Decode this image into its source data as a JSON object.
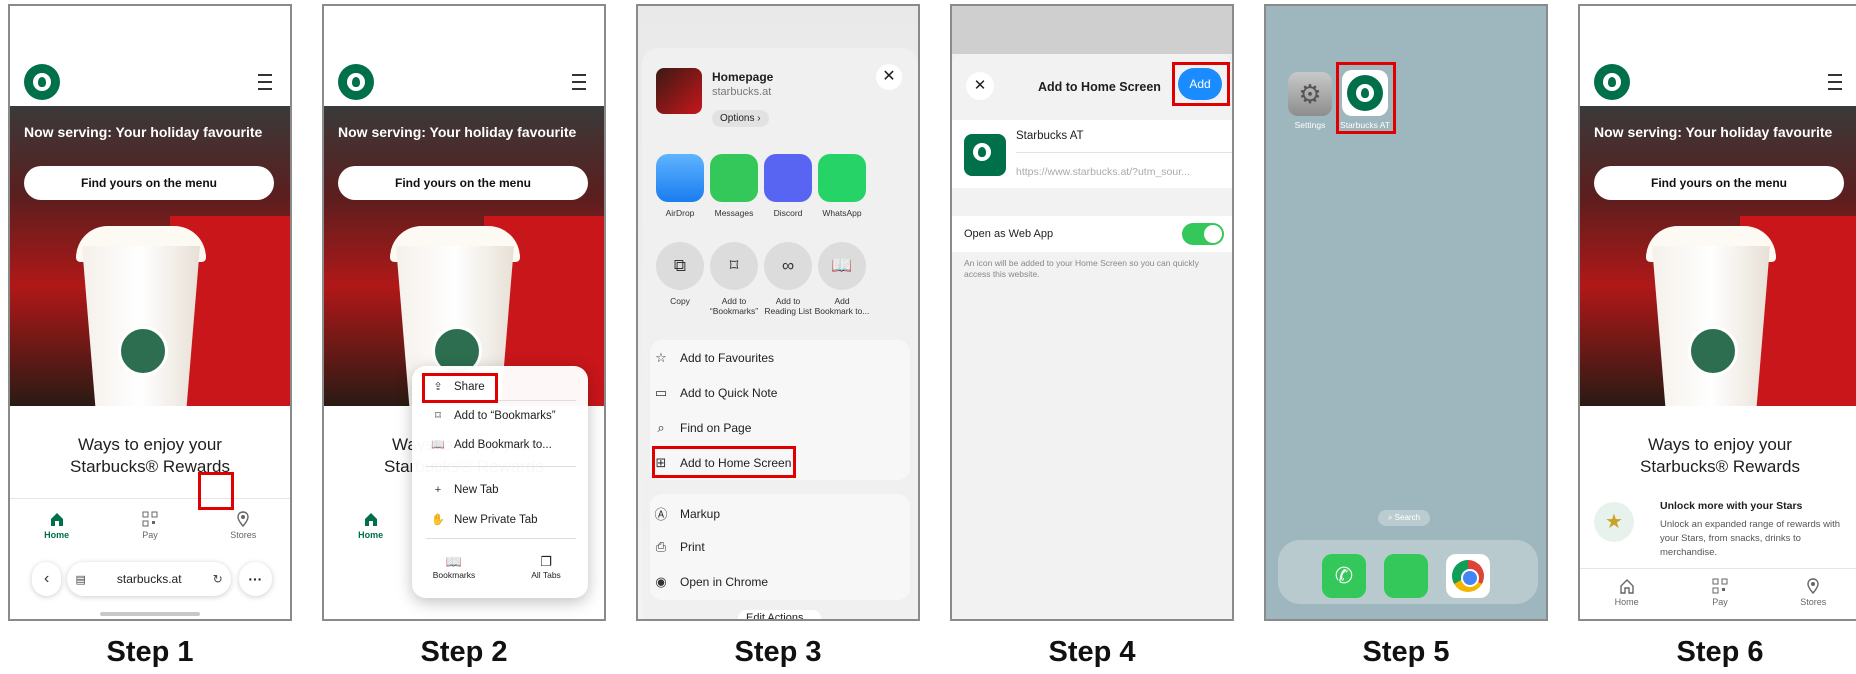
{
  "steps": [
    "Step 1",
    "Step 2",
    "Step 3",
    "Step 4",
    "Step 5",
    "Step 6"
  ],
  "page": {
    "hero_title": "Now serving: Your holiday favourite",
    "hero_button": "Find yours on the menu",
    "rewards_line1": "Ways to enjoy your",
    "rewards_line2": "Starbucks® Rewards",
    "tabs": [
      "Home",
      "Pay",
      "Stores"
    ],
    "url": "starbucks.at"
  },
  "menu": {
    "share": "Share",
    "add_bookmarks": "Add to “Bookmarks”",
    "add_bookmark_to": "Add Bookmark to...",
    "new_tab": "New Tab",
    "new_private_tab": "New Private Tab",
    "bookmarks": "Bookmarks",
    "all_tabs": "All Tabs"
  },
  "share_sheet": {
    "title": "Homepage",
    "domain": "starbucks.at",
    "options": "Options",
    "apps": [
      "AirDrop",
      "Messages",
      "Discord",
      "WhatsApp"
    ],
    "actions": [
      "Copy",
      "Add to\n“Bookmarks”",
      "Add to\nReading List",
      "Add\nBookmark to..."
    ],
    "group1": [
      "Add to Favourites",
      "Add to Quick Note",
      "Find on Page",
      "Add to Home Screen"
    ],
    "group2": [
      "Markup",
      "Print",
      "Open in Chrome"
    ],
    "edit_actions": "Edit Actions..."
  },
  "add_home": {
    "title": "Add to Home Screen",
    "add_button": "Add",
    "name": "Starbucks AT",
    "url": "https://www.starbucks.at/?utm_sour...",
    "web_app_label": "Open as Web App",
    "info": "An icon will be added to your Home Screen so you can quickly access this website."
  },
  "home_screen": {
    "settings": "Settings",
    "app": "Starbucks AT",
    "search": "Search"
  },
  "step6": {
    "unlock_title": "Unlock more with your Stars",
    "unlock_text": "Unlock an expanded range of rewards with your Stars, from snacks, drinks to merchandise."
  },
  "colors": {
    "highlight": "#e00000",
    "starbucks_green": "#00704a",
    "ios_blue": "#1a8cff",
    "toggle_green": "#34c759"
  }
}
